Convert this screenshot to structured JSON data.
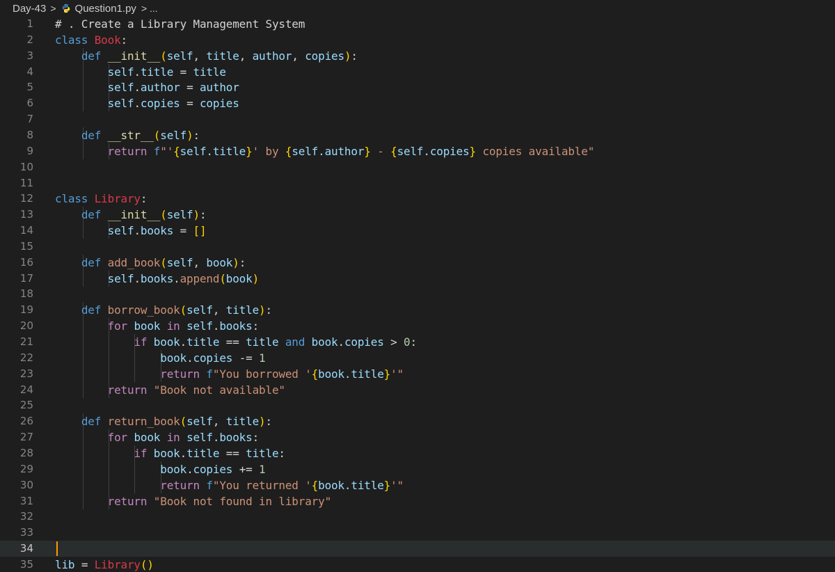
{
  "breadcrumb": {
    "folder": "Day-43",
    "separator": ">",
    "file": "Question1.py",
    "trail": "> ..."
  },
  "colors": {
    "background": "#1e1e1e",
    "current_line": "#2a2d2e",
    "cursor": "#ff9900",
    "line_number": "#858585"
  },
  "icons": {
    "file_icon": "python-icon"
  },
  "editor": {
    "current_line": 34,
    "lines": [
      {
        "n": "1",
        "text": "# . Create a Library Management System"
      },
      {
        "n": "2",
        "text": "class Book:"
      },
      {
        "n": "3",
        "text": "    def __init__(self, title, author, copies):"
      },
      {
        "n": "4",
        "text": "        self.title = title"
      },
      {
        "n": "5",
        "text": "        self.author = author"
      },
      {
        "n": "6",
        "text": "        self.copies = copies"
      },
      {
        "n": "7",
        "text": ""
      },
      {
        "n": "8",
        "text": "    def __str__(self):"
      },
      {
        "n": "9",
        "text": "        return f\"'{self.title}' by {self.author} - {self.copies} copies available\""
      },
      {
        "n": "10",
        "text": ""
      },
      {
        "n": "11",
        "text": ""
      },
      {
        "n": "12",
        "text": "class Library:"
      },
      {
        "n": "13",
        "text": "    def __init__(self):"
      },
      {
        "n": "14",
        "text": "        self.books = []"
      },
      {
        "n": "15",
        "text": ""
      },
      {
        "n": "16",
        "text": "    def add_book(self, book):"
      },
      {
        "n": "17",
        "text": "        self.books.append(book)"
      },
      {
        "n": "18",
        "text": ""
      },
      {
        "n": "19",
        "text": "    def borrow_book(self, title):"
      },
      {
        "n": "20",
        "text": "        for book in self.books:"
      },
      {
        "n": "21",
        "text": "            if book.title == title and book.copies > 0:"
      },
      {
        "n": "22",
        "text": "                book.copies -= 1"
      },
      {
        "n": "23",
        "text": "                return f\"You borrowed '{book.title}'\""
      },
      {
        "n": "24",
        "text": "        return \"Book not available\""
      },
      {
        "n": "25",
        "text": ""
      },
      {
        "n": "26",
        "text": "    def return_book(self, title):"
      },
      {
        "n": "27",
        "text": "        for book in self.books:"
      },
      {
        "n": "28",
        "text": "            if book.title == title:"
      },
      {
        "n": "29",
        "text": "                book.copies += 1"
      },
      {
        "n": "30",
        "text": "                return f\"You returned '{book.title}'\""
      },
      {
        "n": "31",
        "text": "        return \"Book not found in library\""
      },
      {
        "n": "32",
        "text": ""
      },
      {
        "n": "33",
        "text": ""
      },
      {
        "n": "34",
        "text": ""
      },
      {
        "n": "35",
        "text": "lib = Library()"
      }
    ]
  }
}
